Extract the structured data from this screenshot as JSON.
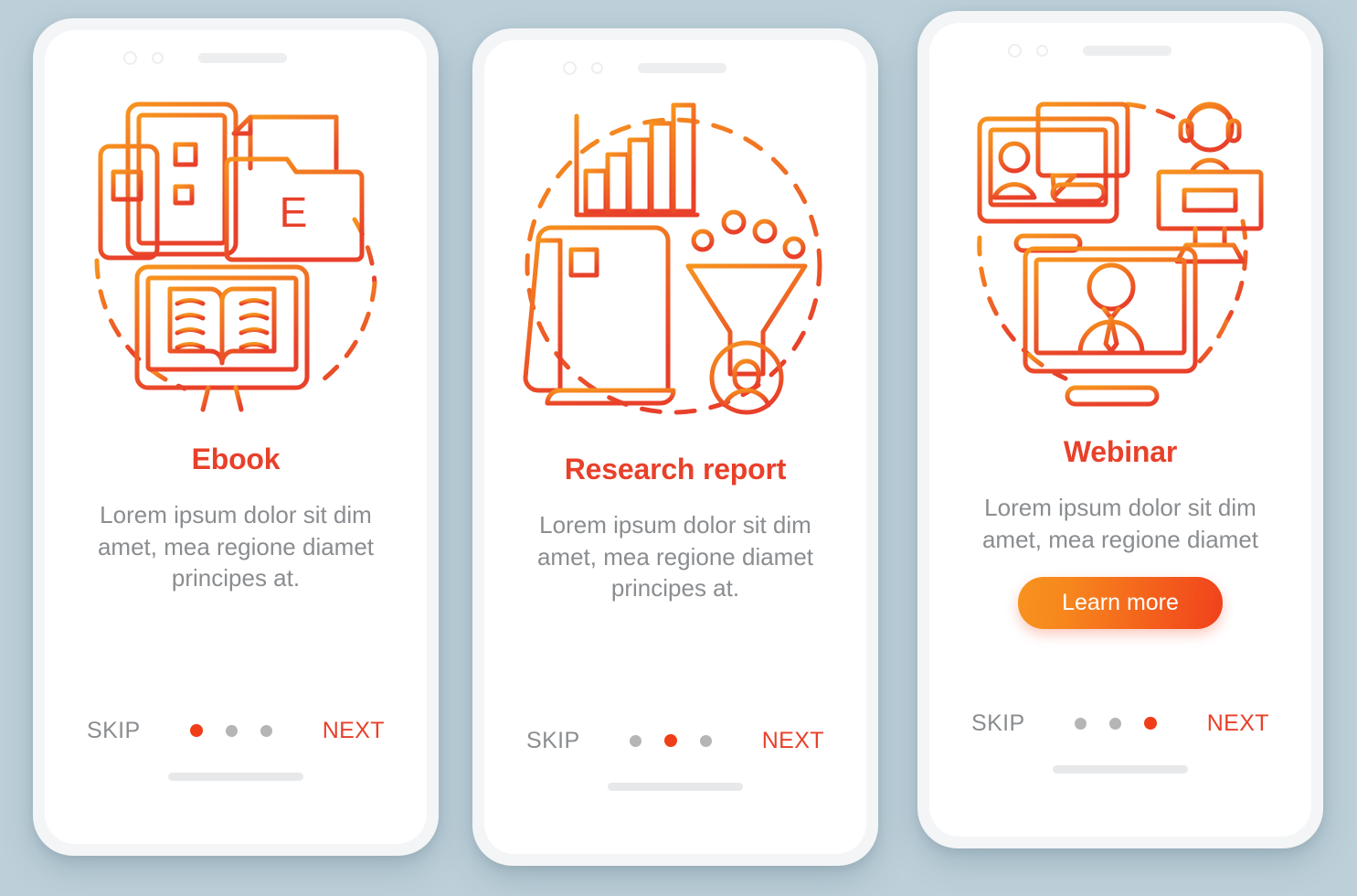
{
  "background_color": "#bdd0da",
  "accent": {
    "title_red": "#e8402a",
    "dot_active": "#f03e18",
    "dot_inactive": "#b5b5b5",
    "body_gray": "#8a8d90",
    "cta_gradient_from": "#f7931e",
    "cta_gradient_to": "#f0411c",
    "icon_orange": "#f7931e",
    "icon_red": "#e8402a"
  },
  "screens": [
    {
      "id": "ebook",
      "illustration": "ebook-devices-illustration",
      "title": "Ebook",
      "description": "Lorem ipsum dolor sit dim amet, mea regione diamet principes at.",
      "cta": null,
      "skip_label": "SKIP",
      "next_label": "NEXT",
      "dots": {
        "count": 3,
        "active_index": 0
      }
    },
    {
      "id": "research-report",
      "illustration": "research-report-illustration",
      "title": "Research report",
      "description": "Lorem ipsum dolor sit dim amet, mea regione diamet principes at.",
      "cta": null,
      "skip_label": "SKIP",
      "next_label": "NEXT",
      "dots": {
        "count": 3,
        "active_index": 1
      }
    },
    {
      "id": "webinar",
      "illustration": "webinar-illustration",
      "title": "Webinar",
      "description": "Lorem ipsum dolor sit dim amet, mea regione diamet",
      "cta": "Learn more",
      "skip_label": "SKIP",
      "next_label": "NEXT",
      "dots": {
        "count": 3,
        "active_index": 2
      }
    }
  ]
}
